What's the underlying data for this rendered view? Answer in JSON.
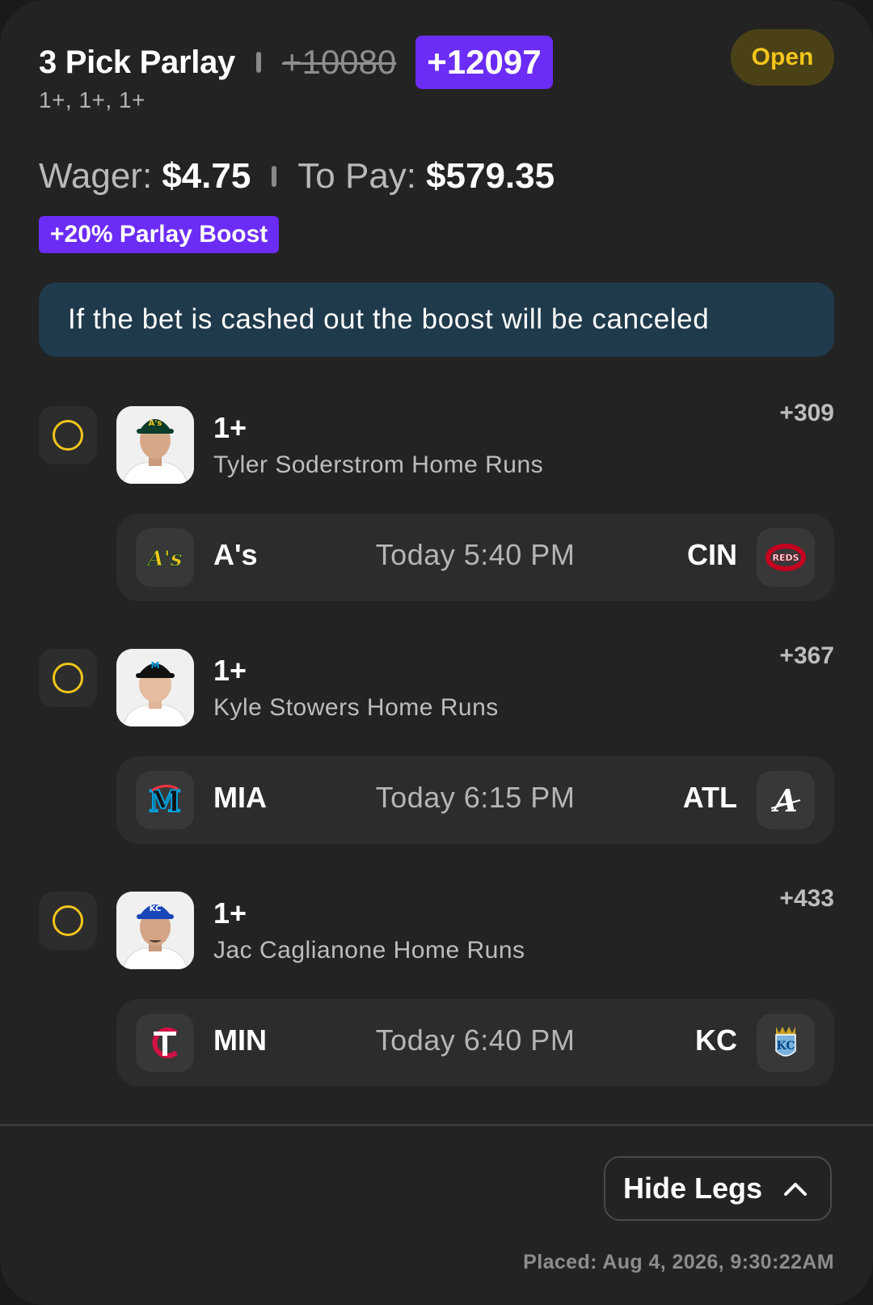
{
  "bet": {
    "title": "3 Pick Parlay",
    "old_odds": "+10080",
    "new_odds": "+12097",
    "status": "Open",
    "subline": "1+, 1+, 1+",
    "wager_label": "Wager:",
    "wager": "$4.75",
    "to_pay_label": "To Pay:",
    "to_pay": "$579.35",
    "boost": "+20% Parlay Boost",
    "notice": "If the bet is cashed out the boost will be canceled"
  },
  "legs": [
    {
      "line": "1+",
      "description": "Tyler Soderstrom Home Runs",
      "odds": "+309",
      "away": "A's",
      "time": "Today 5:40 PM",
      "home": "CIN",
      "away_logo_text": "A's",
      "home_logo_text": "REDS",
      "cap_color": "#0b3d2a",
      "away_color": "#f2c51b",
      "home_color": "#c6011f"
    },
    {
      "line": "1+",
      "description": "Kyle Stowers Home Runs",
      "odds": "+367",
      "away": "MIA",
      "time": "Today 6:15 PM",
      "home": "ATL",
      "away_logo_text": "M",
      "home_logo_text": "A",
      "cap_color": "#111111",
      "away_color": "#00a3e0",
      "home_color": "#ffffff"
    },
    {
      "line": "1+",
      "description": "Jac Caglianone Home Runs",
      "odds": "+433",
      "away": "MIN",
      "time": "Today 6:40 PM",
      "home": "KC",
      "away_logo_text": "TC",
      "home_logo_text": "KC",
      "cap_color": "#1a47b8",
      "away_color": "#d31145",
      "home_color": "#7ab2dd"
    }
  ],
  "footer": {
    "hide_legs": "Hide Legs",
    "placed": "Placed: Aug 4, 2026, 9:30:22AM"
  },
  "colors": {
    "accent": "#6b2cf5",
    "status": "#f2c51b",
    "notice_bg": "#1f3a4b",
    "card": "#232323"
  }
}
